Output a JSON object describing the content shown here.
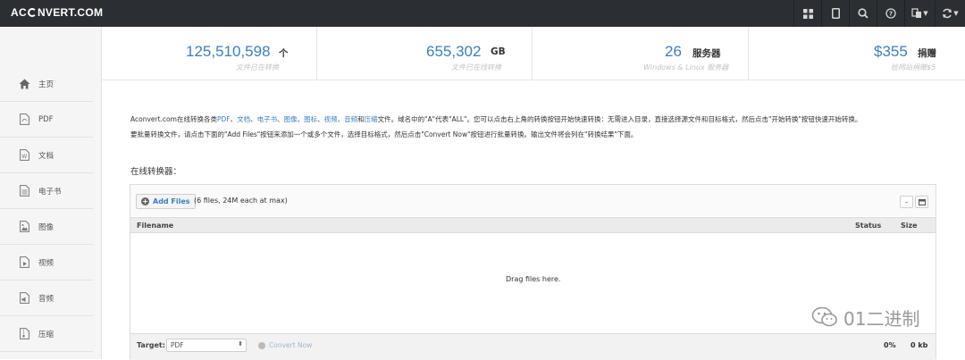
{
  "app": {
    "logo_left": "AC",
    "logo_right": "NVERT.COM"
  },
  "topbar": {
    "buttons": [
      "grid-icon",
      "tablet-icon",
      "search-icon",
      "help-icon",
      "language-icon",
      "refresh-icon"
    ]
  },
  "sidebar": {
    "items": [
      {
        "label": "主页",
        "icon": "home-icon"
      },
      {
        "label": "PDF",
        "icon": "pdf-file-icon"
      },
      {
        "label": "文档",
        "icon": "word-file-icon"
      },
      {
        "label": "电子书",
        "icon": "ebook-icon"
      },
      {
        "label": "图像",
        "icon": "image-file-icon"
      },
      {
        "label": "视频",
        "icon": "video-file-icon"
      },
      {
        "label": "音频",
        "icon": "audio-file-icon"
      },
      {
        "label": "压缩",
        "icon": "archive-file-icon"
      }
    ]
  },
  "stats": [
    {
      "value": "125,510,598",
      "unit": "个",
      "sub": "文件已在转换"
    },
    {
      "value": "655,302",
      "unit": "GB",
      "sub": "文件已在线转换"
    },
    {
      "value": "26",
      "unit": "服务器",
      "sub": "Windows & Linux 服务器"
    },
    {
      "value": "$355",
      "unit": "捐赠",
      "sub": "给网站捐赠$5"
    }
  ],
  "description": {
    "line1_prefix": "Aconvert.com在线转换各类",
    "link_pdf": "PDF",
    "sep": "、",
    "link_doc": "文档",
    "link_ebook": "电子书",
    "link_image": "图像",
    "link_icon": "图标",
    "link_video": "视频",
    "link_audio": "音频",
    "and": "和",
    "link_archive": "压缩",
    "line1_suffix": "文件。域名中的\"A\"代表\"ALL\"。您可以点击右上角的转换按钮开始快速转换：无需进入目录，直接选择源文件和目标格式，然后点击\"开始转换\"按钮快速开始转换。",
    "line2": "要批量转换文件，请点击下面的\"Add Files\"按钮来添加一个或多个文件，选择目标格式，然后点击\"Convert Now\"按钮进行批量转换。输出文件将会列在\"转换结果\"下面。"
  },
  "converter": {
    "section_title": "在线转换器：",
    "add_files_label": "Add Files",
    "add_files_note": "(6 files, 24M each at max)",
    "columns": {
      "filename": "Filename",
      "status": "Status",
      "size": "Size"
    },
    "drop_message": "Drag files here.",
    "target_label": "Target:",
    "target_value": "PDF",
    "convert_label": "Convert Now",
    "progress": "0%",
    "total_size": "0 kb"
  },
  "watermark": {
    "text": "01二进制"
  }
}
